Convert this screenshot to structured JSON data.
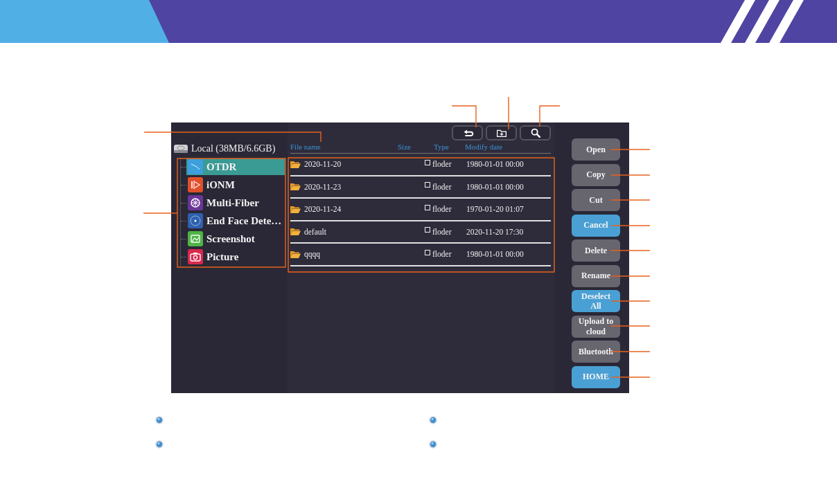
{
  "tree": {
    "root": "Local (38MB/6.6GB)",
    "items": [
      {
        "label": "OTDR",
        "selected": true,
        "kind": "trace",
        "color": "#3d9fdc"
      },
      {
        "label": "iONM",
        "selected": false,
        "kind": "play",
        "color": "#e0502a"
      },
      {
        "label": "Multi-Fiber",
        "selected": false,
        "kind": "fan",
        "color": "#6a3597"
      },
      {
        "label": "End Face Dete…",
        "selected": false,
        "kind": "dot",
        "color": "#2f5fae"
      },
      {
        "label": "Screenshot",
        "selected": false,
        "kind": "image",
        "color": "#4fb446"
      },
      {
        "label": "Picture",
        "selected": false,
        "kind": "camera",
        "color": "#d9284e"
      }
    ]
  },
  "toolbar": [
    {
      "kind": "back"
    },
    {
      "kind": "newfolder"
    },
    {
      "kind": "search"
    }
  ],
  "files": {
    "columns": [
      "File name",
      "Size",
      "Type",
      "Modify date"
    ],
    "rows": [
      {
        "name": "2020-11-20",
        "checked": false,
        "type": "floder",
        "date": "1980-01-01 00:00"
      },
      {
        "name": "2020-11-23",
        "checked": false,
        "type": "floder",
        "date": "1980-01-01 00:00"
      },
      {
        "name": "2020-11-24",
        "checked": false,
        "type": "floder",
        "date": "1970-01-20 01:07"
      },
      {
        "name": "default",
        "checked": false,
        "type": "floder",
        "date": "2020-11-20 17:30"
      },
      {
        "name": "qqqq",
        "checked": false,
        "type": "floder",
        "date": "1980-01-01 00:00"
      }
    ]
  },
  "actions": [
    {
      "label": "Open",
      "highlighted": false
    },
    {
      "label": "Copy",
      "highlighted": false
    },
    {
      "label": "Cut",
      "highlighted": false
    },
    {
      "label": "Cancel",
      "highlighted": true
    },
    {
      "label": "Delete",
      "highlighted": false
    },
    {
      "label": "Rename",
      "highlighted": false
    },
    {
      "label": "Deselect All",
      "highlighted": true
    },
    {
      "label": "Upload to cloud",
      "highlighted": false
    },
    {
      "label": "Bluetooth",
      "highlighted": false
    },
    {
      "label": "HOME",
      "highlighted": true
    }
  ]
}
